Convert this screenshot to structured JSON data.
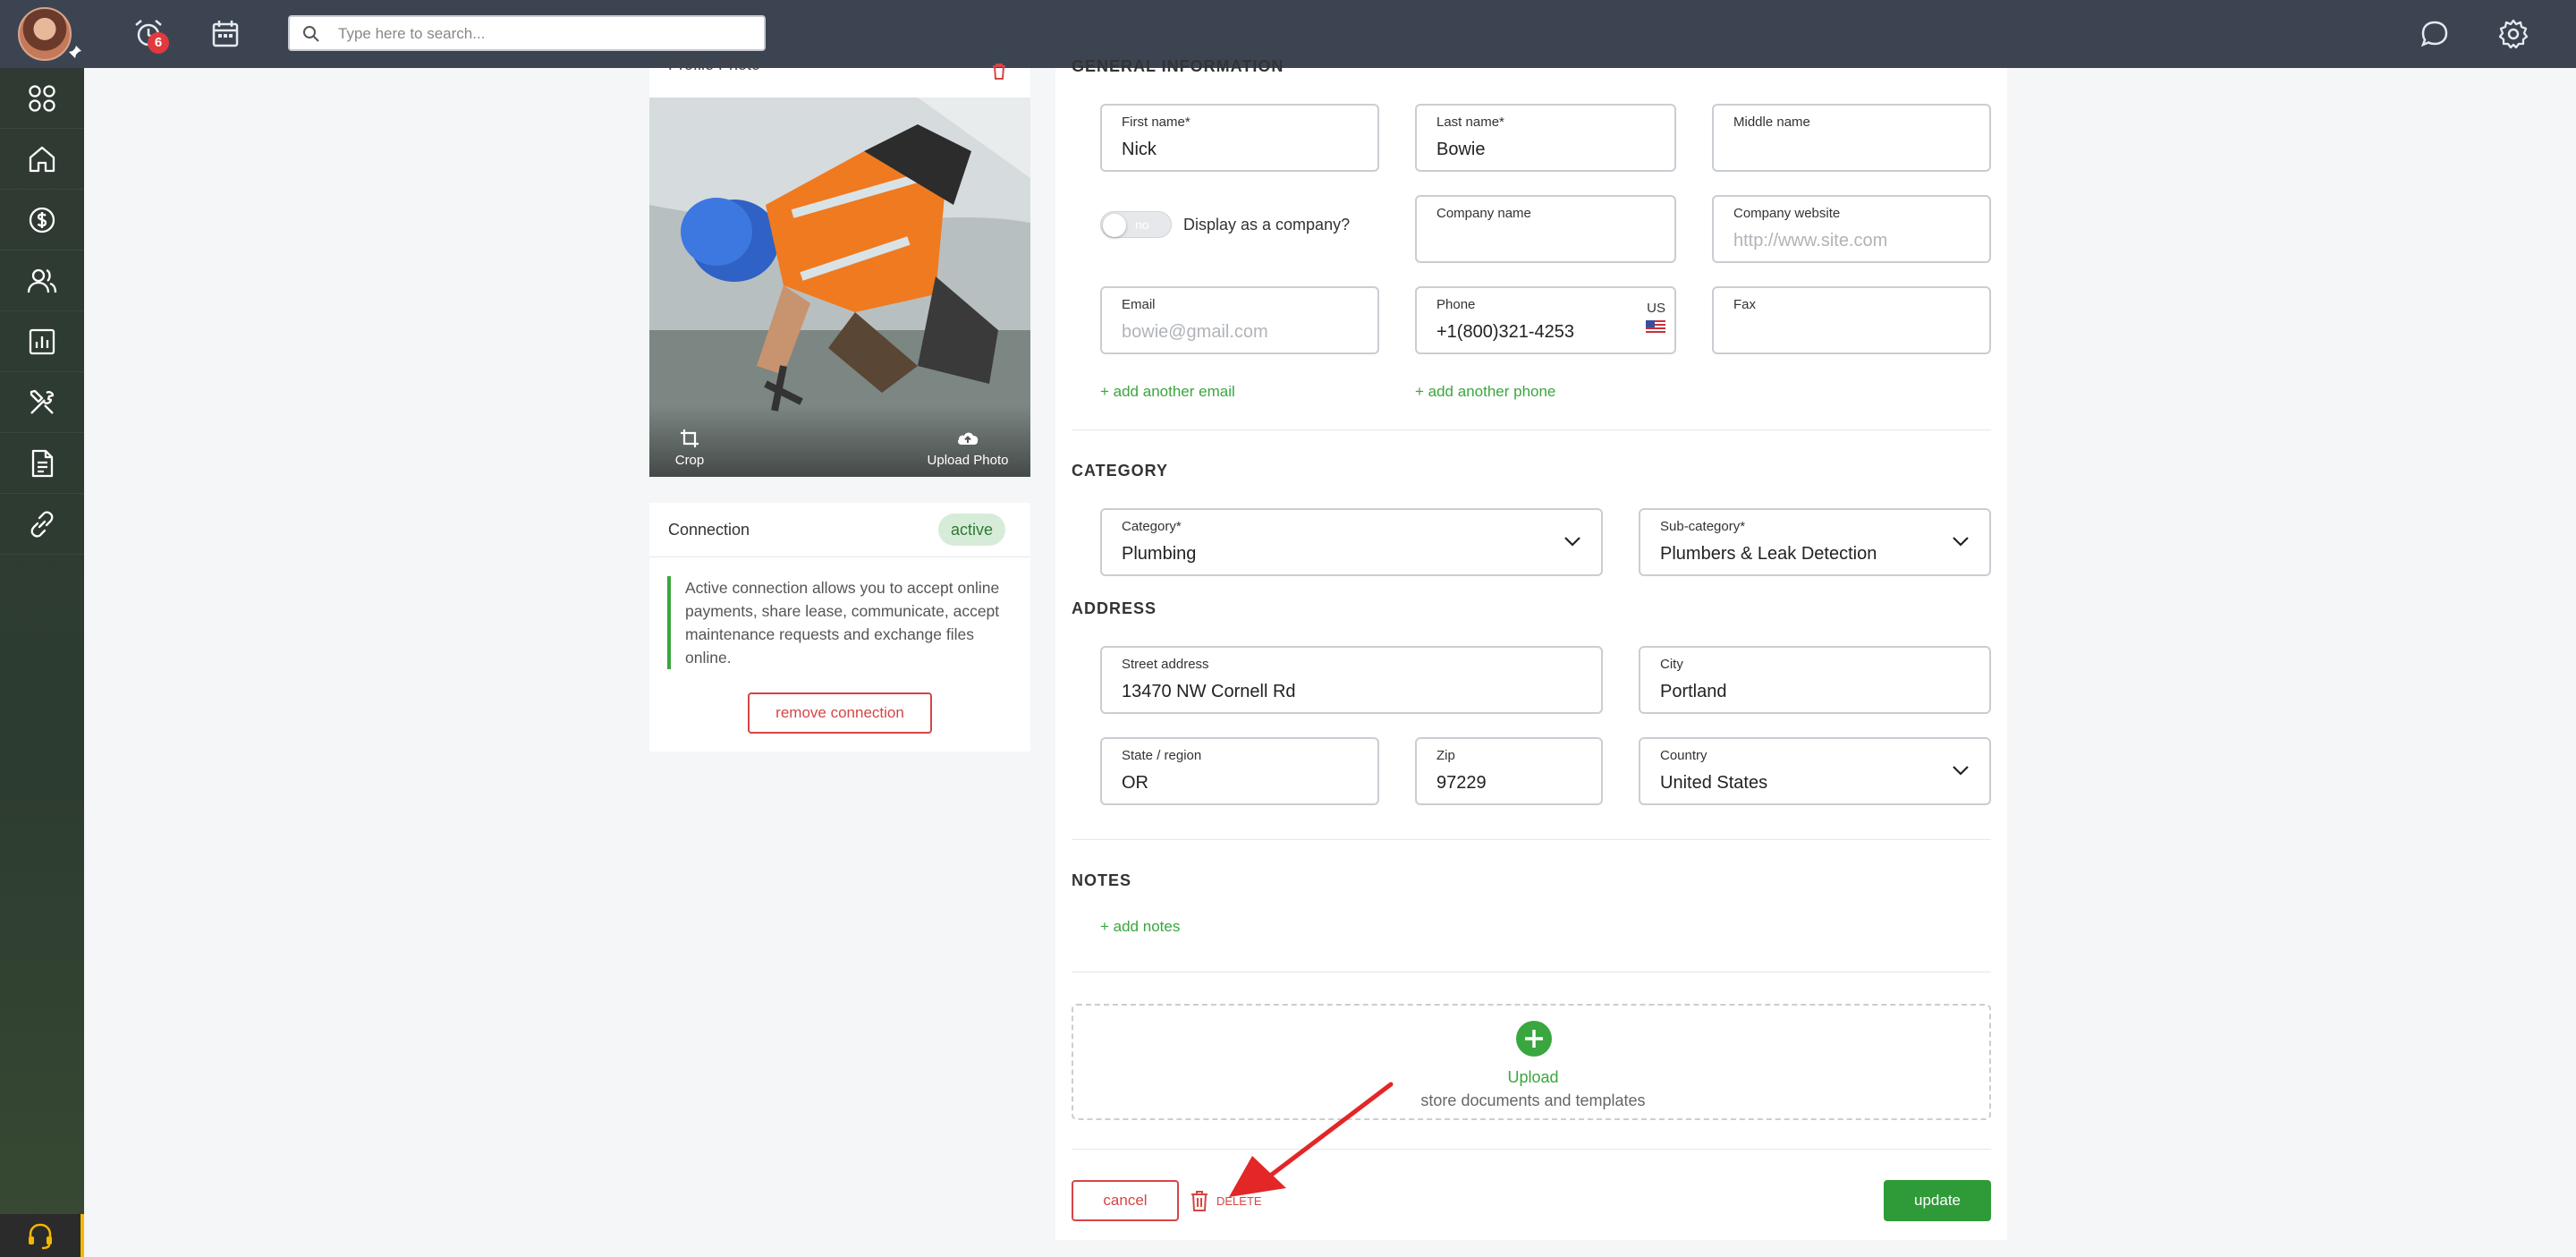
{
  "topbar": {
    "notification_count": "6",
    "search_placeholder": "Type here to search..."
  },
  "sidebar": {
    "items": [
      "apps",
      "home",
      "payments",
      "contacts",
      "reports",
      "maintenance",
      "documents",
      "connections"
    ]
  },
  "profile_photo": {
    "title": "Profile Photo",
    "crop_label": "Crop",
    "upload_label": "Upload Photo"
  },
  "connection": {
    "title": "Connection",
    "status": "active",
    "description": "Active connection allows you to accept online payments, share lease, communicate, accept maintenance requests and exchange files online.",
    "remove_label": "remove connection"
  },
  "general": {
    "section_title": "GENERAL INFORMATION",
    "first_name": {
      "label": "First name*",
      "value": "Nick"
    },
    "last_name": {
      "label": "Last name*",
      "value": "Bowie"
    },
    "middle_name": {
      "label": "Middle name",
      "value": ""
    },
    "company_toggle": {
      "state": "no",
      "label": "Display as a company?"
    },
    "company_name": {
      "label": "Company name",
      "value": ""
    },
    "company_website": {
      "label": "Company website",
      "placeholder": "http://www.site.com"
    },
    "email": {
      "label": "Email",
      "placeholder": "bowie@gmail.com"
    },
    "phone": {
      "label": "Phone",
      "value": "+1(800)321-4253",
      "country": "US"
    },
    "fax": {
      "label": "Fax",
      "value": ""
    },
    "add_email": "+ add another email",
    "add_phone": "+ add another phone"
  },
  "category": {
    "section_title": "CATEGORY",
    "category": {
      "label": "Category*",
      "value": "Plumbing"
    },
    "subcategory": {
      "label": "Sub-category*",
      "value": "Plumbers & Leak Detection"
    }
  },
  "address": {
    "section_title": "ADDRESS",
    "street": {
      "label": "Street address",
      "value": "13470 NW Cornell Rd"
    },
    "city": {
      "label": "City",
      "value": "Portland"
    },
    "state": {
      "label": "State / region",
      "value": "OR"
    },
    "zip": {
      "label": "Zip",
      "value": "97229"
    },
    "country": {
      "label": "Country",
      "value": "United States"
    }
  },
  "notes": {
    "section_title": "NOTES",
    "add_notes": "+ add notes"
  },
  "upload": {
    "title": "Upload",
    "subtitle": "store documents and templates"
  },
  "actions": {
    "cancel": "cancel",
    "delete": "DELETE",
    "update": "update"
  },
  "colors": {
    "topbar": "#3c4452",
    "accent_green": "#3aa63f",
    "danger_red": "#d64545"
  }
}
